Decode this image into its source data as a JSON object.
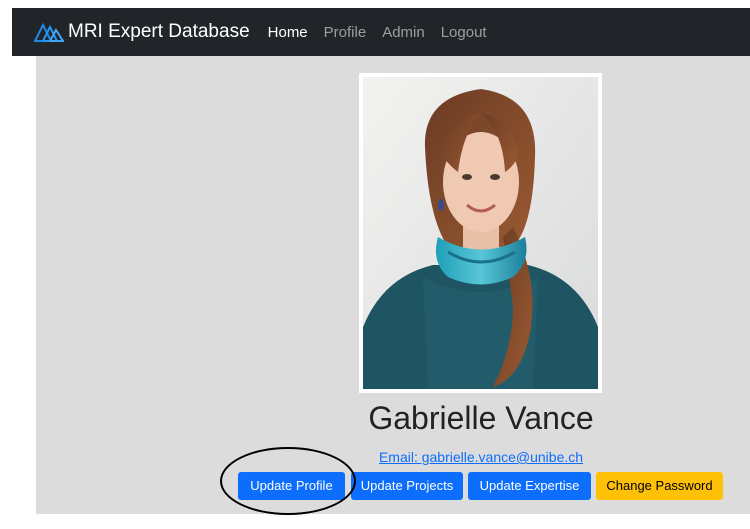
{
  "navbar": {
    "brand": "MRI Expert Database",
    "links": [
      {
        "label": "Home",
        "active": true
      },
      {
        "label": "Profile",
        "active": false
      },
      {
        "label": "Admin",
        "active": false
      },
      {
        "label": "Logout",
        "active": false
      }
    ]
  },
  "profile": {
    "name": "Gabrielle Vance",
    "email_text": "Email: gabrielle.vance@unibe.ch",
    "photo_alt": "portrait-photo"
  },
  "actions": {
    "update_profile": "Update Profile",
    "update_projects": "Update Projects",
    "update_expertise": "Update Expertise",
    "change_password": "Change Password"
  },
  "colors": {
    "navbar_bg": "#212529",
    "panel_bg": "#dcdcdc",
    "primary": "#0d6efd",
    "warning": "#ffc107",
    "brand_icon": "#1e88e5"
  },
  "icons": {
    "brand": "mountain-logo-icon"
  }
}
